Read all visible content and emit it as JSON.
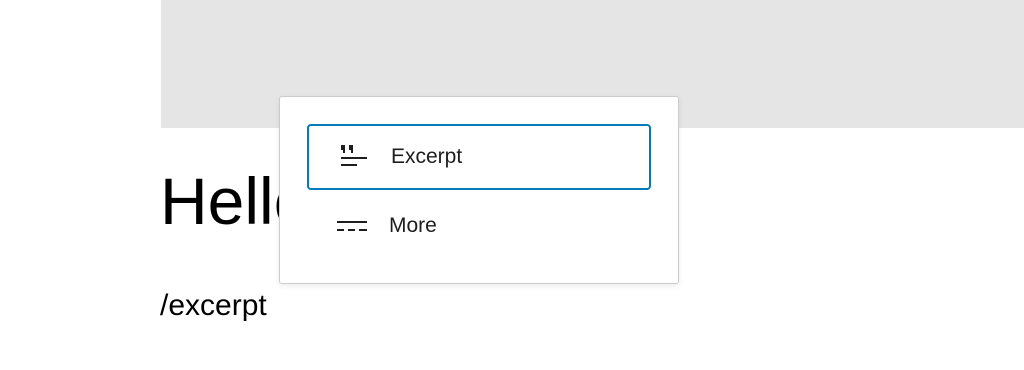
{
  "editor": {
    "heading_text": "Hello",
    "paragraph_text": "/excerpt"
  },
  "autocomplete": {
    "items": [
      {
        "label": "Excerpt",
        "icon": "excerpt-icon",
        "selected": true
      },
      {
        "label": "More",
        "icon": "more-icon",
        "selected": false
      }
    ]
  },
  "colors": {
    "accent": "#007cba",
    "placeholder_block": "#e5e5e5"
  }
}
